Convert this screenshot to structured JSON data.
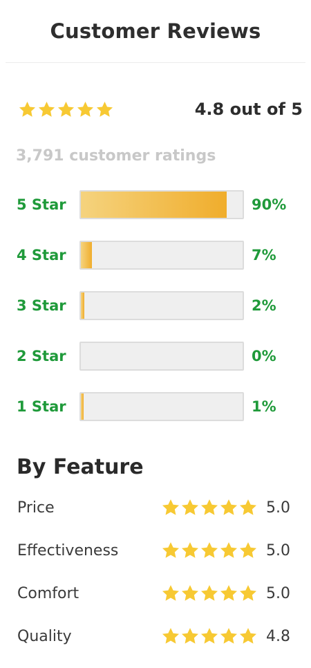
{
  "header": {
    "title": "Customer Reviews"
  },
  "summary": {
    "stars": 5,
    "rating_text": "4.8 out of 5",
    "ratings_count": "3,791 customer ratings"
  },
  "distribution": [
    {
      "label": "5 Star",
      "percent_text": "90%",
      "percent": 90
    },
    {
      "label": "4 Star",
      "percent_text": "7%",
      "percent": 7
    },
    {
      "label": "3 Star",
      "percent_text": "2%",
      "percent": 2
    },
    {
      "label": "2 Star",
      "percent_text": "0%",
      "percent": 0
    },
    {
      "label": "1 Star",
      "percent_text": "1%",
      "percent": 1
    }
  ],
  "by_feature": {
    "title": "By Feature",
    "items": [
      {
        "name": "Price",
        "score": "5.0",
        "stars": 5
      },
      {
        "name": "Effectiveness",
        "score": "5.0",
        "stars": 5
      },
      {
        "name": "Comfort",
        "score": "5.0",
        "stars": 5
      },
      {
        "name": "Quality",
        "score": "4.8",
        "stars": 5
      }
    ]
  },
  "colors": {
    "star": "#f7c933",
    "green": "#1f9a3a",
    "bar_fill_start": "#f5d37e",
    "bar_fill_end": "#f0ad2c"
  },
  "icons": {
    "star": "star-icon"
  }
}
